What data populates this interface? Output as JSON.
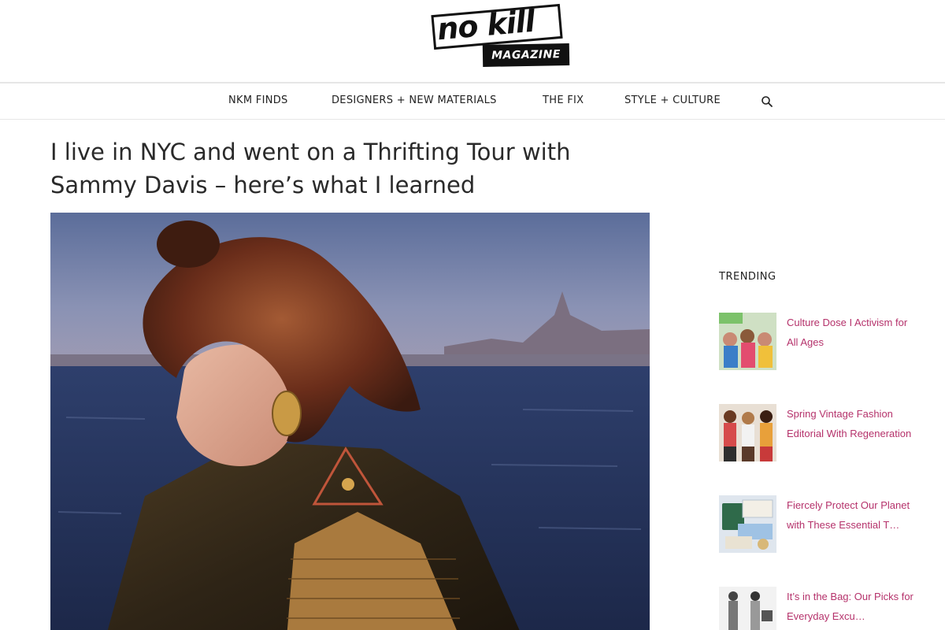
{
  "header": {
    "logo_top": "no kill",
    "logo_bottom": "MAGAZINE"
  },
  "nav": {
    "items": [
      {
        "label": "NKM FINDS"
      },
      {
        "label": "DESIGNERS + NEW MATERIALS"
      },
      {
        "label": "THE FIX"
      },
      {
        "label": "STYLE + CULTURE"
      }
    ],
    "search_icon": "search-icon"
  },
  "article": {
    "title": "I live in NYC and went on a Thrifting Tour with Sammy Davis – here’s what I learned"
  },
  "sidebar": {
    "heading": "TRENDING",
    "items": [
      {
        "title": "Culture Dose I Activism for All Ages"
      },
      {
        "title": "Spring Vintage Fashion Editorial With Regeneration"
      },
      {
        "title": "Fiercely Protect Our Planet with These Essential T…"
      },
      {
        "title": "It’s in the Bag: Our Picks for Everyday Excu…"
      }
    ]
  },
  "colors": {
    "link": "#b5326b",
    "text": "#222222",
    "divider": "#e6e6e6"
  }
}
